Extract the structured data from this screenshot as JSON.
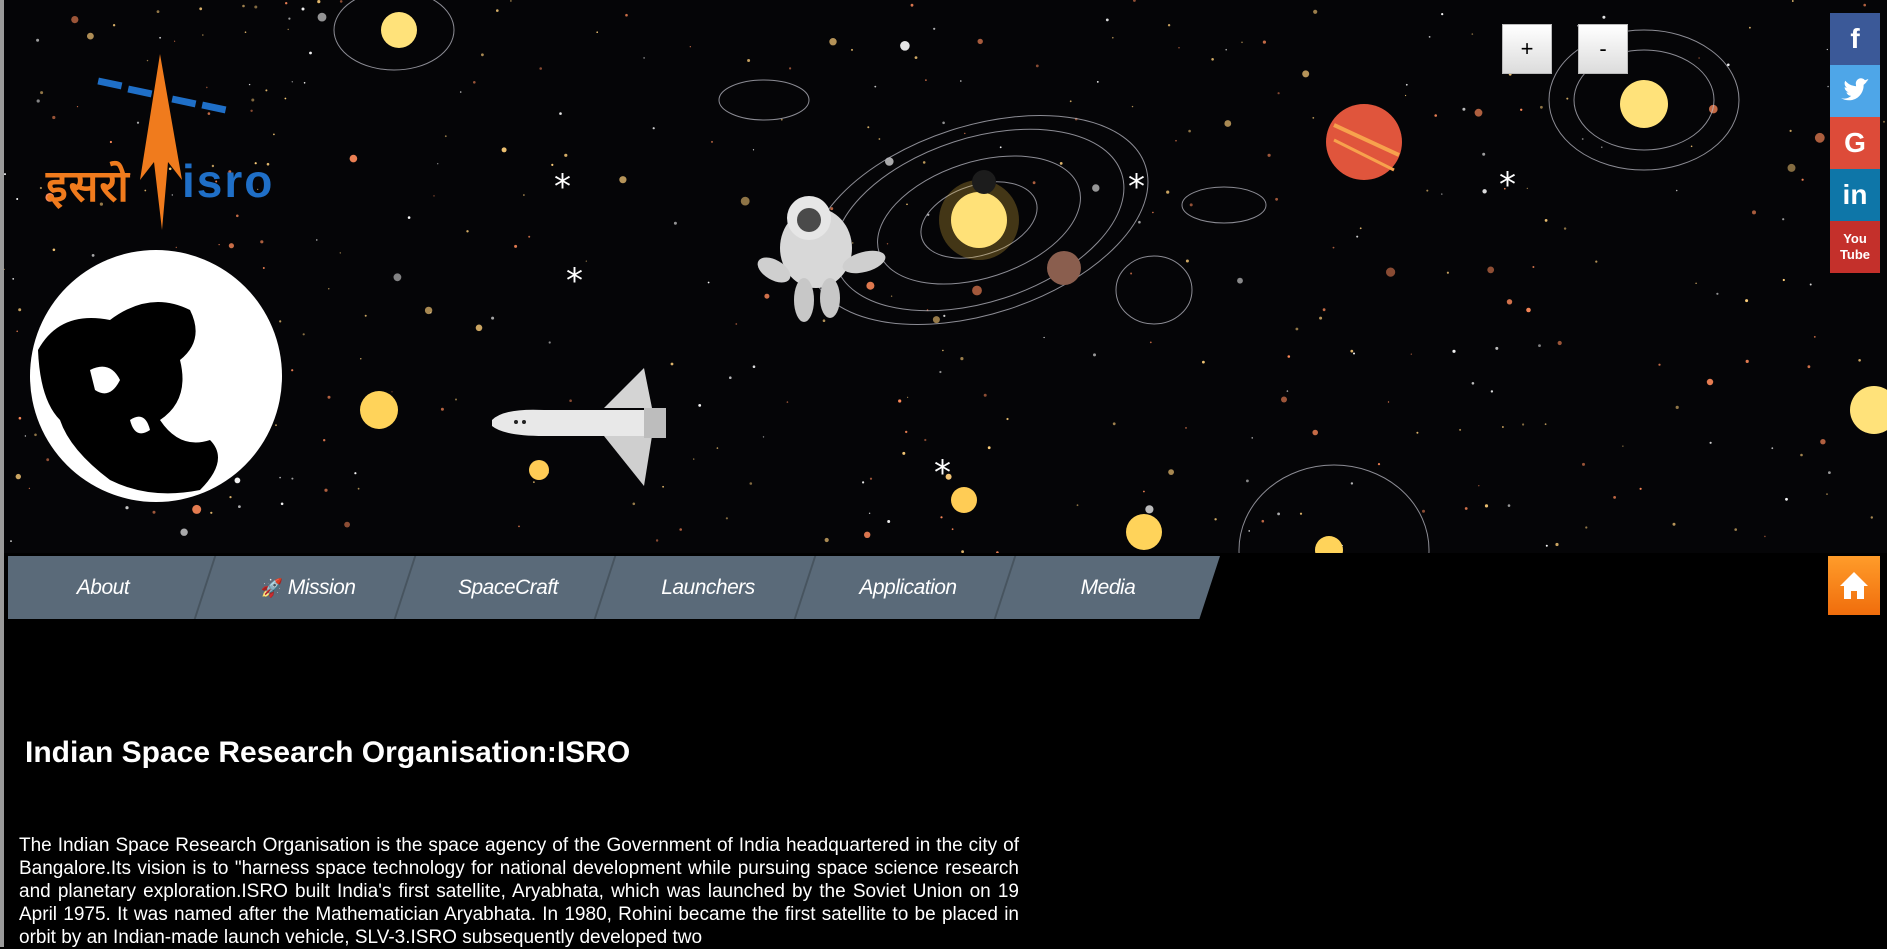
{
  "logo": {
    "hindi_text": "इसरो",
    "english_text": "isro"
  },
  "zoom": {
    "plus_label": "+",
    "minus_label": "-"
  },
  "social": [
    {
      "name": "facebook",
      "label": "f",
      "color": "#3b5998"
    },
    {
      "name": "twitter",
      "label": "🐦",
      "color": "#4ea6e8"
    },
    {
      "name": "google",
      "label": "G",
      "color": "#dd4b39"
    },
    {
      "name": "linkedin",
      "label": "in",
      "color": "#0e76a8"
    },
    {
      "name": "youtube",
      "label": "You Tube",
      "color": "#c4302b"
    }
  ],
  "nav": {
    "items": [
      {
        "label": "About"
      },
      {
        "label": "Mission"
      },
      {
        "label": "SpaceCraft"
      },
      {
        "label": "Launchers"
      },
      {
        "label": "Application"
      },
      {
        "label": "Media"
      }
    ]
  },
  "content": {
    "title": "Indian Space Research Organisation:ISRO",
    "paragraph": "The Indian Space Research Organisation is the space agency of the Government of India headquartered in the city of Bangalore.Its vision is to \"harness space technology for national development while pursuing space science research and planetary exploration.ISRO built India's first satellite, Aryabhata, which was launched by the Soviet Union on 19 April 1975. It was named after the Mathematician Aryabhata. In 1980, Rohini became the first satellite to be placed in orbit by an Indian-made launch vehicle, SLV-3.ISRO subsequently developed two"
  },
  "colors": {
    "nav_bg": "#5a6a79",
    "home_button": "#f57f17",
    "logo_orange": "#f07b1d",
    "logo_blue": "#1f6fc7"
  }
}
